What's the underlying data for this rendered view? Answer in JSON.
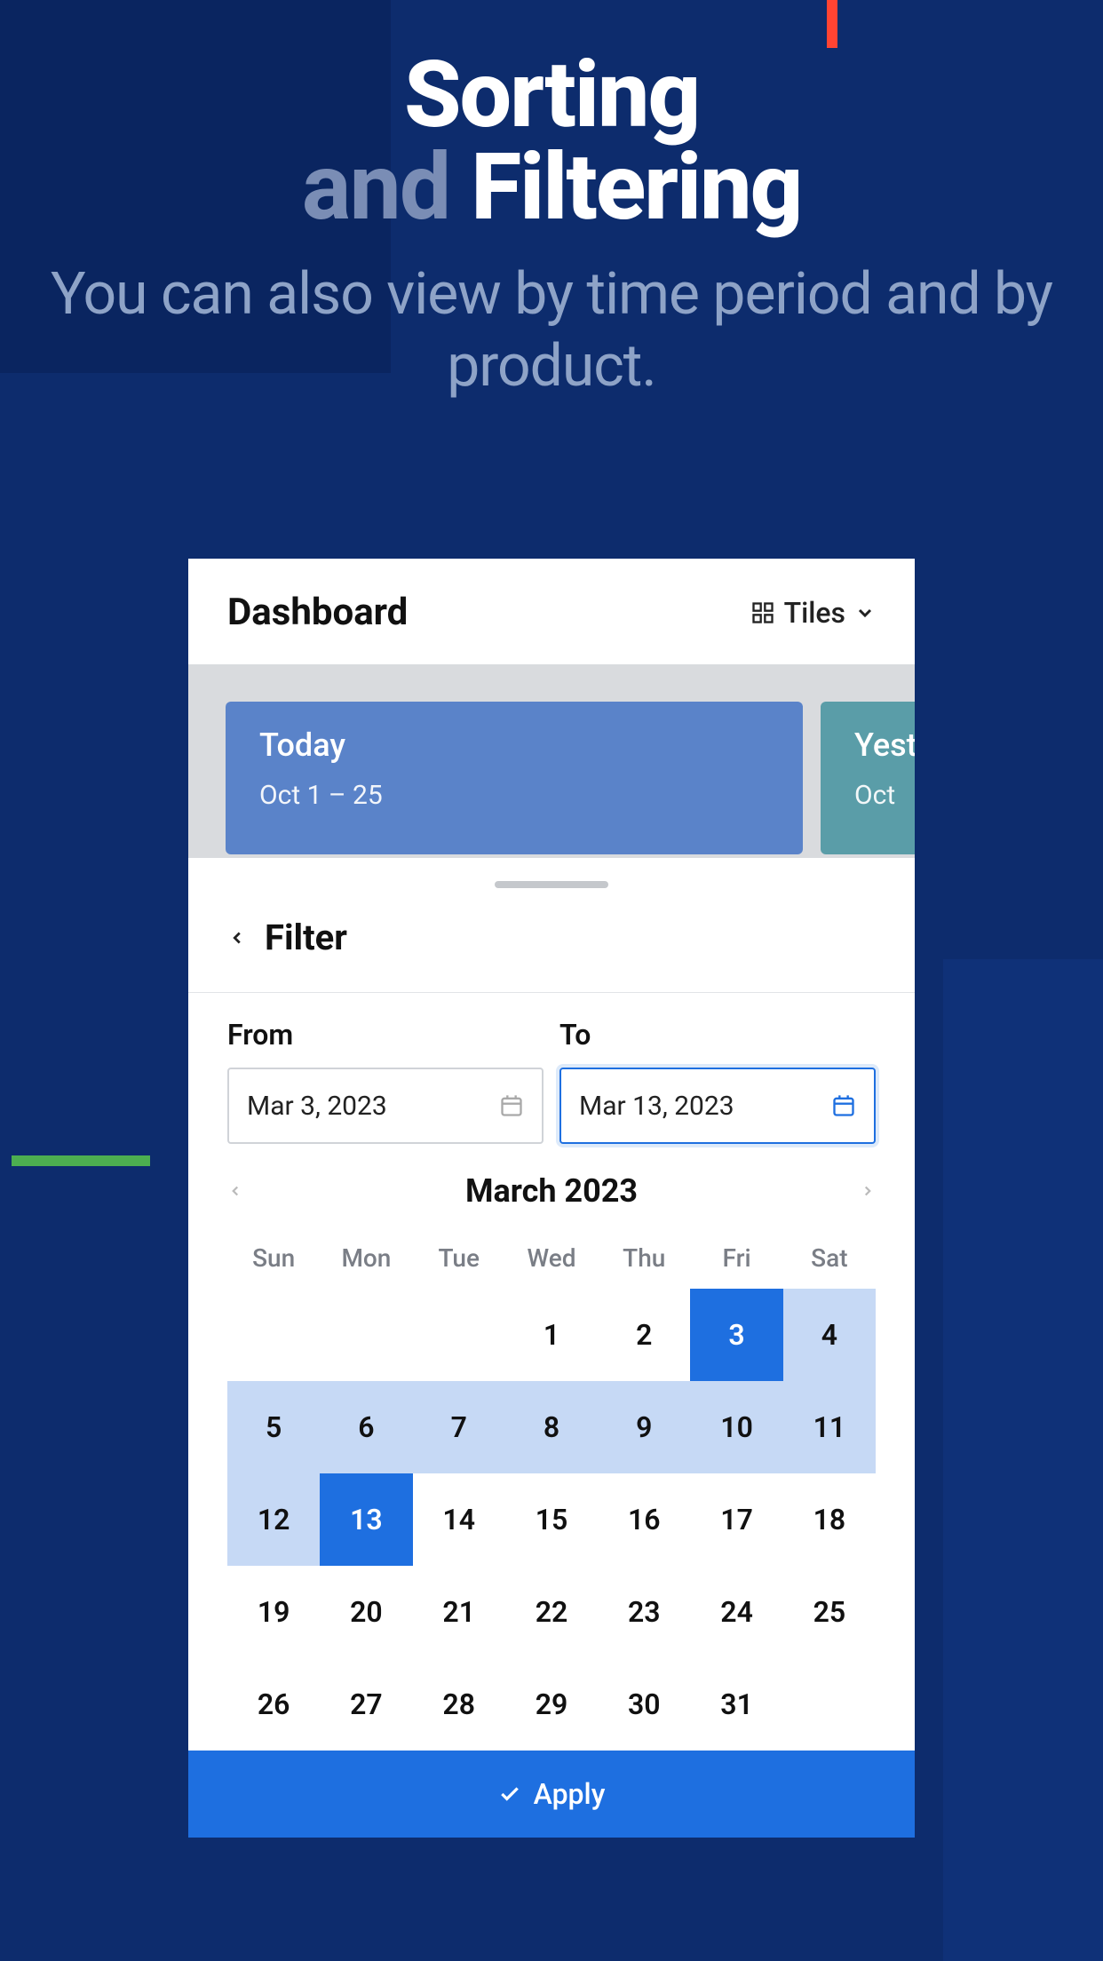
{
  "hero": {
    "title_1": "Sorting",
    "title_2a": "and",
    "title_2b": "Filtering",
    "subtitle": "You can also view by time period and by product."
  },
  "dashboard": {
    "title": "Dashboard",
    "view_toggle": "Tiles"
  },
  "cards": [
    {
      "title": "Today",
      "date": "Oct 1 –  25"
    },
    {
      "title": "Yest",
      "date": "Oct "
    }
  ],
  "filter": {
    "title": "Filter",
    "from_label": "From",
    "to_label": "To",
    "from_value": "Mar 3, 2023",
    "to_value": "Mar 13, 2023"
  },
  "calendar": {
    "month_label": "March 2023",
    "dow": [
      "Sun",
      "Mon",
      "Tue",
      "Wed",
      "Thu",
      "Fri",
      "Sat"
    ],
    "leading_blanks": 3,
    "days_in_month": 31,
    "range_start": 3,
    "range_end": 13
  },
  "apply_label": "Apply"
}
